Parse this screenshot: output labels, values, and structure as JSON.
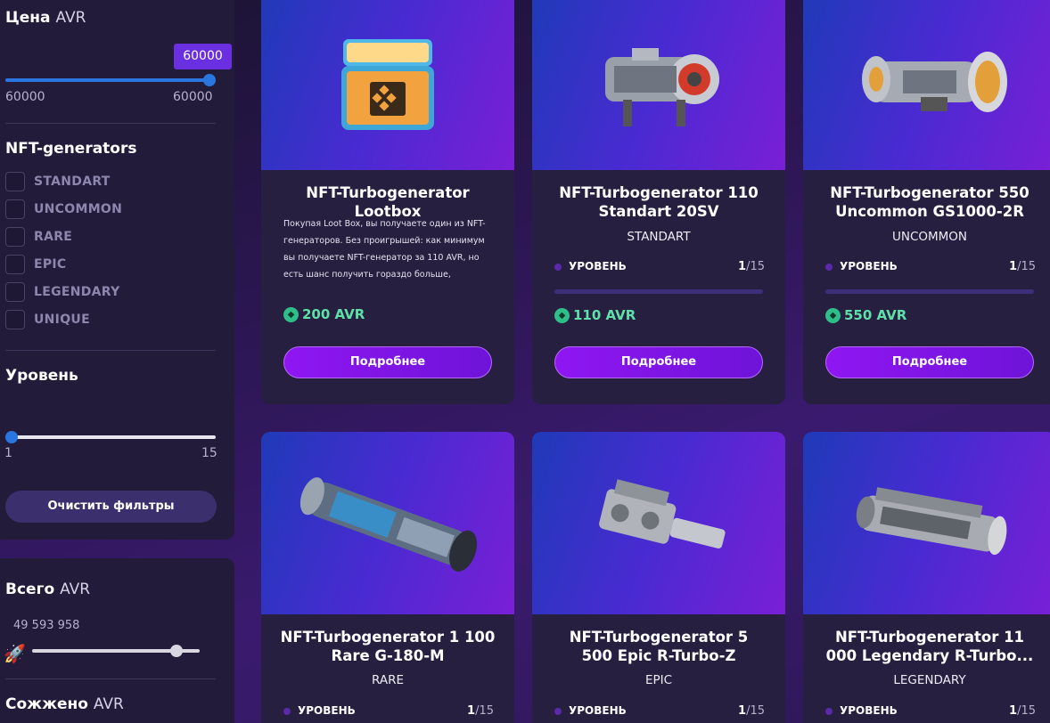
{
  "filters": {
    "price": {
      "title": "Цена",
      "unit": "AVR",
      "badge": "60000",
      "min_label": "60000",
      "max_label": "60000"
    },
    "generators": {
      "title": "NFT-generators",
      "options": [
        "STANDART",
        "UNCOMMON",
        "RARE",
        "EPIC",
        "LEGENDARY",
        "UNIQUE"
      ]
    },
    "level": {
      "title": "Уровень",
      "min_label": "1",
      "max_label": "15"
    },
    "clear_label": "Очистить фильтры"
  },
  "totals": {
    "total": {
      "title": "Всего",
      "unit": "AVR",
      "value": "49 593 958"
    },
    "burned": {
      "title": "Сожжено",
      "unit": "AVR"
    }
  },
  "cards": [
    {
      "title_line1": "NFT-Turbogenerator",
      "title_line2": "Lootbox",
      "description": "Покупая Loot Box, вы получаете один из NFT-генераторов. Без проигрышей: как минимум вы получаете NFT-генератор за 110 AVR, но есть шанс получить гораздо больше,",
      "price": "200 AVR",
      "button": "Подробнее"
    },
    {
      "title_line1": "NFT-Turbogenerator 110",
      "title_line2": "Standart 20SV",
      "rarity": "STANDART",
      "level_label": "УРОВЕНЬ",
      "level_current": "1",
      "level_max": "/15",
      "price": "110 AVR",
      "button": "Подробнее"
    },
    {
      "title_line1": "NFT-Turbogenerator 550",
      "title_line2": "Uncommon GS1000-2R",
      "rarity": "UNCOMMON",
      "level_label": "УРОВЕНЬ",
      "level_current": "1",
      "level_max": "/15",
      "price": "550 AVR",
      "button": "Подробнее"
    },
    {
      "title_line1": "NFT-Turbogenerator 1 100",
      "title_line2": "Rare G-180-M",
      "rarity": "RARE",
      "level_label": "УРОВЕНЬ",
      "level_current": "1",
      "level_max": "/15"
    },
    {
      "title_line1": "NFT-Turbogenerator 5",
      "title_line2": "500 Epic R-Turbo-Z",
      "rarity": "EPIC",
      "level_label": "УРОВЕНЬ",
      "level_current": "1",
      "level_max": "/15"
    },
    {
      "title_line1": "NFT-Turbogenerator 11",
      "title_line2": "000 Legendary R-Turbo...",
      "rarity": "LEGENDARY",
      "level_label": "УРОВЕНЬ",
      "level_current": "1",
      "level_max": "/15"
    }
  ],
  "colors": {
    "accent": "#6a2fe0",
    "slider_blue": "#2a76e0",
    "price_green": "#5fe0a8",
    "button_purple": "#9016f2"
  },
  "icons": {
    "coin": "coin-icon",
    "rocket": "rocket-icon",
    "level_dot": "level-dot-icon"
  }
}
